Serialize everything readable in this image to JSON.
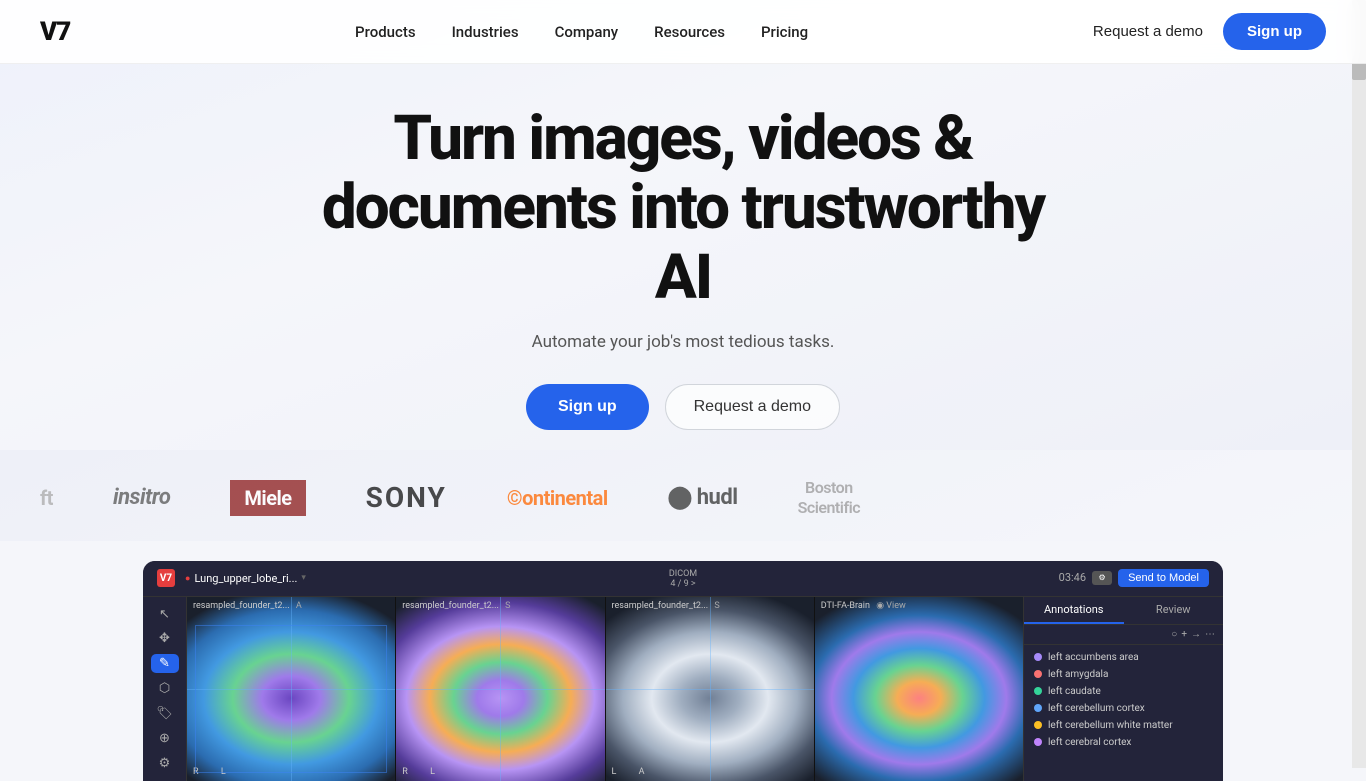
{
  "nav": {
    "logo": "V7",
    "links": [
      {
        "label": "Products",
        "id": "products"
      },
      {
        "label": "Industries",
        "id": "industries"
      },
      {
        "label": "Company",
        "id": "company"
      },
      {
        "label": "Resources",
        "id": "resources"
      },
      {
        "label": "Pricing",
        "id": "pricing"
      }
    ],
    "request_demo": "Request a demo",
    "sign_up": "Sign up"
  },
  "hero": {
    "title_line1": "Turn images, videos &",
    "title_line2": "documents into trustworthy AI",
    "subtitle": "Automate your job's most tedious tasks.",
    "cta_primary": "Sign up",
    "cta_secondary": "Request a demo"
  },
  "logos": [
    {
      "id": "softly",
      "text": "ft",
      "style": "plain"
    },
    {
      "id": "insitro",
      "text": "insitro",
      "style": "plain"
    },
    {
      "id": "miele",
      "text": "Miele",
      "style": "miele"
    },
    {
      "id": "sony",
      "text": "SONY",
      "style": "sony"
    },
    {
      "id": "continental",
      "text": "Continental",
      "style": "continental"
    },
    {
      "id": "hudl",
      "text": "○ hudl",
      "style": "hudl"
    },
    {
      "id": "boston",
      "text": "Boston Scientific",
      "style": "boston"
    }
  ],
  "app": {
    "logo": "V7",
    "tab": "Lung_upper_lobe_ri...",
    "dicom_label": "DICOM",
    "dicom_nav": "4 / 9 >",
    "timer": "03:46",
    "send_model": "Send to Model",
    "panels": [
      {
        "label": "resampled_founder_t2...",
        "type": "A",
        "bg": "1"
      },
      {
        "label": "resampled_founder_t2...",
        "type": "S",
        "bg": "2"
      },
      {
        "label": "resampled_founder_t2...",
        "type": "S",
        "bg": "3"
      },
      {
        "label": "DTI-FA-Brain",
        "type": "View",
        "bg": "4"
      }
    ],
    "annotations_tab": "Annotations",
    "review_tab": "Review",
    "annotations": [
      {
        "color": "#a78bfa",
        "text": "left accumbens area"
      },
      {
        "color": "#f87171",
        "text": "left amygdala"
      },
      {
        "color": "#34d399",
        "text": "left caudate"
      },
      {
        "color": "#60a5fa",
        "text": "left cerebellum cortex"
      },
      {
        "color": "#fbbf24",
        "text": "left cerebellum white matter"
      },
      {
        "color": "#c084fc",
        "text": "left cerebral cortex"
      }
    ]
  }
}
